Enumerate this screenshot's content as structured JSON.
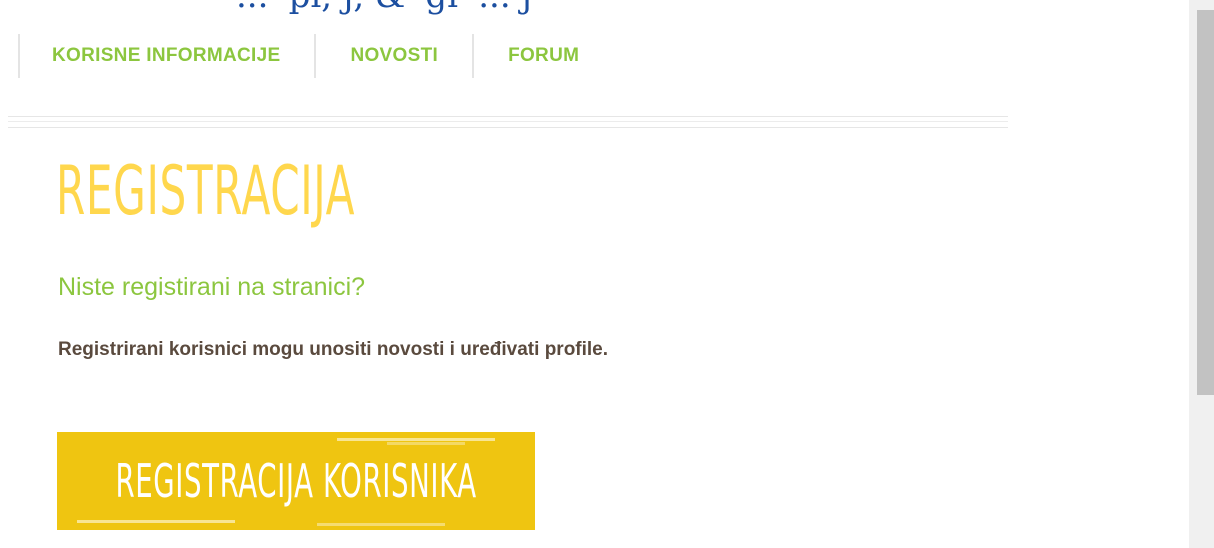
{
  "header": {
    "cut_text": "... 'pi, j, & 'gi' ... j"
  },
  "nav": {
    "items": [
      {
        "label": "KORISNE INFORMACIJE"
      },
      {
        "label": "NOVOSTI"
      },
      {
        "label": "FORUM"
      }
    ]
  },
  "main": {
    "title": "REGISTRACIJA",
    "subheading": "Niste registirani na stranici?",
    "description": "Registrirani korisnici mogu unositi novosti i uređivati profile.",
    "cta_label": "REGISTRACIJA KORISNIKA"
  },
  "colors": {
    "accent_green": "#8cc63f",
    "title_yellow": "#ffd74d",
    "button_yellow": "#efc511",
    "text_brown": "#5a4a3e"
  }
}
